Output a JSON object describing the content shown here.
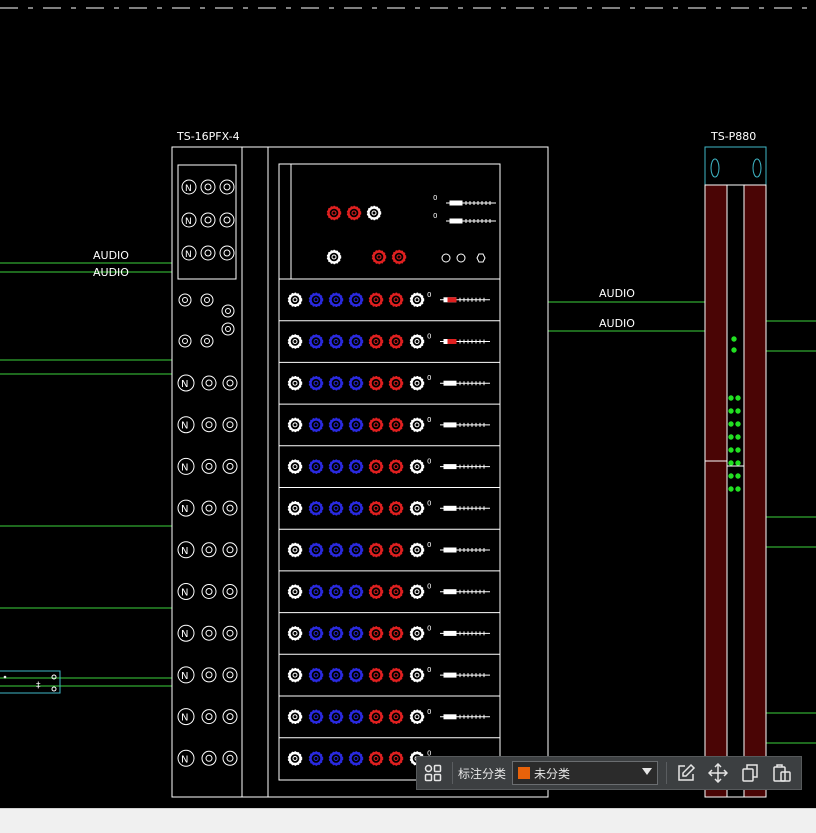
{
  "colors": {
    "background": "#000000",
    "line_white": "#ffffff",
    "wire_green": "#3bd23b",
    "led_green": "#22e022",
    "knob_red": "#e02020",
    "knob_blue": "#2a2ae0",
    "rail_fill": "#4a0505",
    "cyan": "#3fb8c8",
    "category_swatch": "#e8620a"
  },
  "drawing": {
    "mixer_title": "TS-16PFX-4",
    "amp_title": "TS-P880",
    "wire_labels": [
      "AUDIO",
      "AUDIO",
      "AUDIO",
      "AUDIO"
    ],
    "channel_count": 12,
    "led_rows": 8
  },
  "toolbar": {
    "grid_icon": "grid-icon",
    "category_label": "标注分类",
    "category_value": "未分类",
    "edit_icon": "edit-icon",
    "move_icon": "move-icon",
    "copy_icon": "copy-icon",
    "paste_icon": "paste-icon"
  }
}
